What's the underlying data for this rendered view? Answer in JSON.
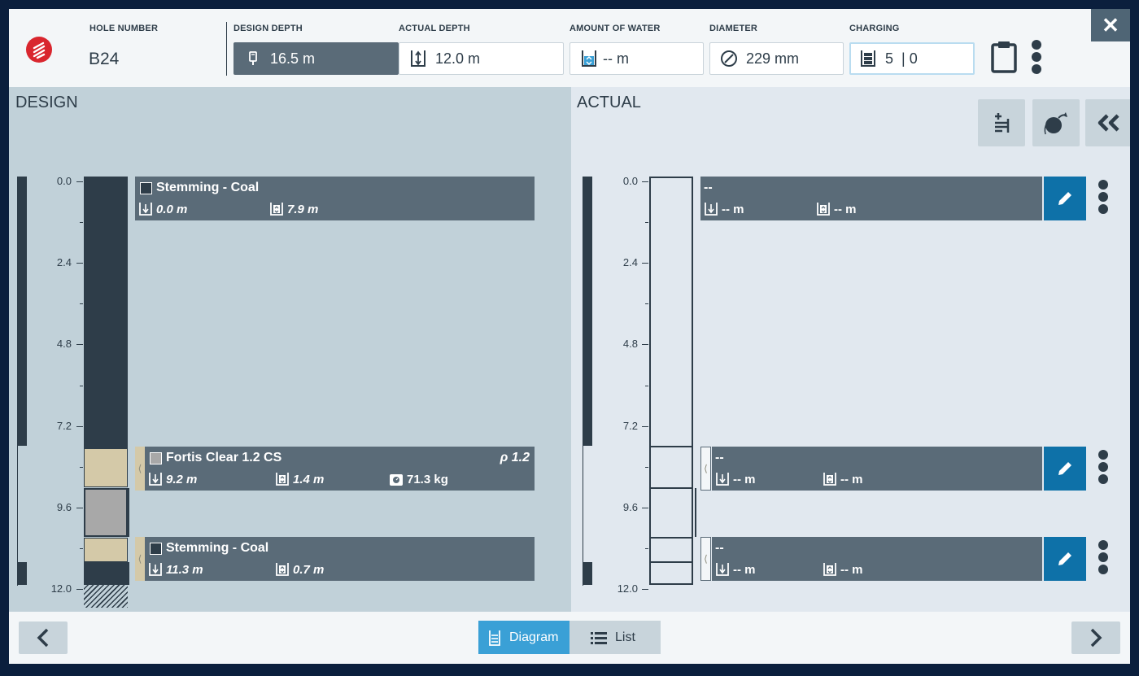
{
  "header": {
    "hole_number_label": "HOLE NUMBER",
    "hole_number": "B24",
    "design_depth_label": "DESIGN DEPTH",
    "design_depth": "16.5 m",
    "actual_depth_label": "ACTUAL DEPTH",
    "actual_depth": "12.0 m",
    "water_label": "AMOUNT OF WATER",
    "water": "-- m",
    "diameter_label": "DIAMETER",
    "diameter": "229 mm",
    "charging_label": "CHARGING",
    "charging": "5  | 0",
    "close": "✕"
  },
  "design": {
    "title": "DESIGN",
    "scale": [
      "0.0",
      "2.4",
      "4.8",
      "7.2",
      "9.6",
      "12.0"
    ],
    "decks": [
      {
        "name": "Stemming - Coal",
        "depth": "0.0 m",
        "length": "7.9 m",
        "color": "#2e3d49"
      },
      {
        "name": "Fortis Clear 1.2 CS",
        "depth": "9.2 m",
        "length": "1.4 m",
        "mass": "71.3 kg",
        "density": "ρ 1.2",
        "color": "#a8a8a8"
      },
      {
        "name": "Stemming - Coal",
        "depth": "11.3 m",
        "length": "0.7 m",
        "color": "#2e3d49"
      }
    ]
  },
  "actual": {
    "title": "ACTUAL",
    "scale": [
      "0.0",
      "2.4",
      "4.8",
      "7.2",
      "9.6",
      "12.0"
    ],
    "decks": [
      {
        "name": "--",
        "depth": "-- m",
        "length": "-- m"
      },
      {
        "name": "--",
        "depth": "-- m",
        "length": "-- m"
      },
      {
        "name": "--",
        "depth": "-- m",
        "length": "-- m"
      }
    ]
  },
  "footer": {
    "diagram": "Diagram",
    "list": "List"
  },
  "colors": {
    "accent": "#3aa0d6",
    "edit": "#0e71a8",
    "deck": "#5a6b78",
    "column": "#2e3d49",
    "stemming_fill": "#d4c9a8",
    "product_fill": "#a8a8a8"
  }
}
